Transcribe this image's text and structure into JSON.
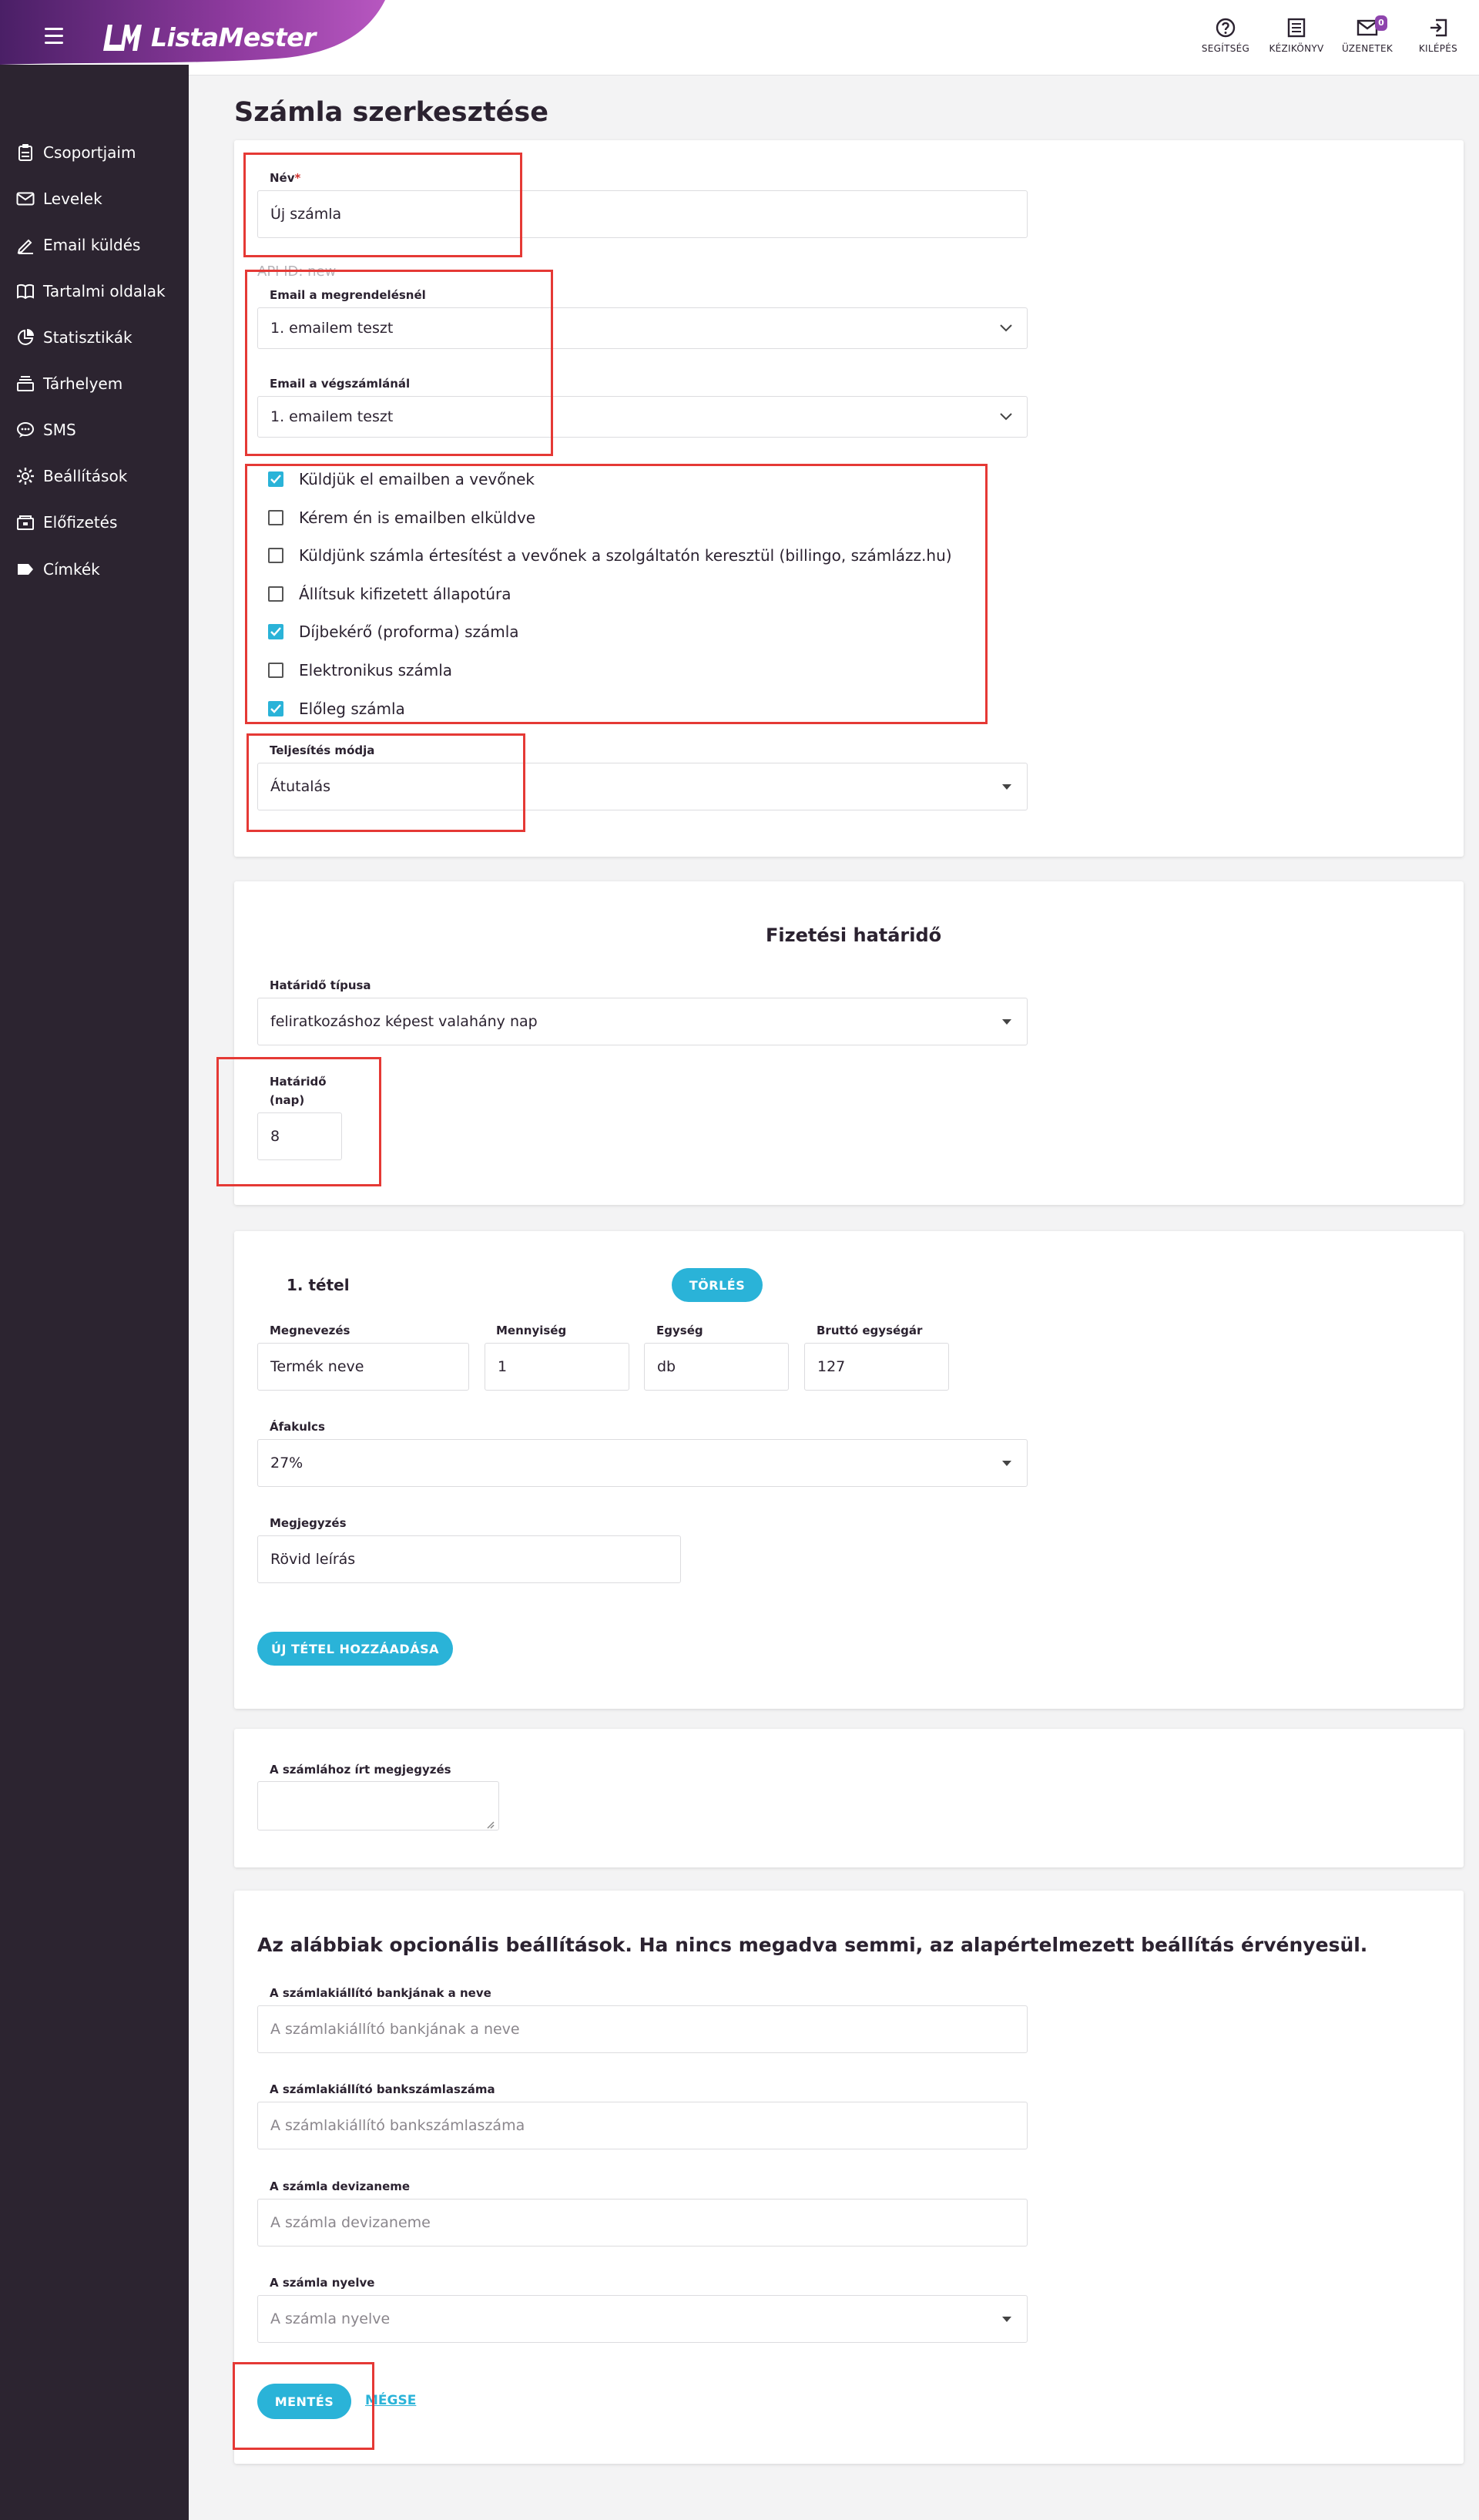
{
  "app": {
    "brand": "ListaMester"
  },
  "header": {
    "actions": [
      {
        "label": "SEGÍTSÉG",
        "icon": "help-circle-icon"
      },
      {
        "label": "KÉZIKÖNYV",
        "icon": "manual-icon"
      },
      {
        "label": "ÜZENETEK",
        "icon": "mail-icon",
        "badge": "0"
      },
      {
        "label": "KILÉPÉS",
        "icon": "logout-icon"
      }
    ]
  },
  "sidebar": {
    "items": [
      {
        "label": "Csoportjaim",
        "icon": "clipboard-icon"
      },
      {
        "label": "Levelek",
        "icon": "envelope-icon"
      },
      {
        "label": "Email küldés",
        "icon": "pen-icon"
      },
      {
        "label": "Tartalmi oldalak",
        "icon": "book-icon"
      },
      {
        "label": "Statisztikák",
        "icon": "pie-chart-icon"
      },
      {
        "label": "Tárhelyem",
        "icon": "storage-icon"
      },
      {
        "label": "SMS",
        "icon": "sms-icon"
      },
      {
        "label": "Beállítások",
        "icon": "gear-icon"
      },
      {
        "label": "Előfizetés",
        "icon": "subscription-icon"
      },
      {
        "label": "Címkék",
        "icon": "tag-icon"
      }
    ]
  },
  "page": {
    "title": "Számla szerkesztése"
  },
  "form": {
    "name_label": "Név",
    "name_required": "*",
    "name_value": "Új számla",
    "api_id": "API ID: new",
    "email_order_label": "Email a megrendelésnél",
    "email_order_value": "1. emailem teszt",
    "email_final_label": "Email a végszámlánál",
    "email_final_value": "1. emailem teszt",
    "checkboxes": [
      {
        "label": "Küldjük el emailben a vevőnek",
        "checked": true
      },
      {
        "label": "Kérem én is emailben elküldve",
        "checked": false
      },
      {
        "label": "Küldjünk számla értesítést a vevőnek a szolgáltatón keresztül (billingo, számlázz.hu)",
        "checked": false
      },
      {
        "label": "Állítsuk kifizetett állapotúra",
        "checked": false
      },
      {
        "label": "Díjbekérő (proforma) számla",
        "checked": true
      },
      {
        "label": "Elektronikus számla",
        "checked": false
      },
      {
        "label": "Előleg számla",
        "checked": true
      }
    ],
    "fulfillment_label": "Teljesítés módja",
    "fulfillment_value": "Átutalás"
  },
  "deadline": {
    "title": "Fizetési határidő",
    "type_label": "Határidő típusa",
    "type_value": "feliratkozáshoz képest valahány nap",
    "days_label_1": "Határidő",
    "days_label_2": "(nap)",
    "days_value": "8"
  },
  "item": {
    "title": "1. tétel",
    "delete_label": "TÖRLÉS",
    "name_label": "Megnevezés",
    "name_value": "Termék neve",
    "qty_label": "Mennyiség",
    "qty_value": "1",
    "unit_label": "Egység",
    "unit_value": "db",
    "price_label": "Bruttó egységár",
    "price_value": "127",
    "vat_label": "Áfakulcs",
    "vat_value": "27%",
    "note_label": "Megjegyzés",
    "note_value": "Rövid leírás",
    "add_label": "ÚJ TÉTEL HOZZÁADÁSA"
  },
  "invoice_note": {
    "label": "A számlához írt megjegyzés",
    "value": ""
  },
  "optional": {
    "title": "Az alábbiak opcionális beállítások. Ha nincs megadva semmi, az alapértelmezett beállítás érvényesül.",
    "bank_name_label": "A számlakiállító bankjának a neve",
    "bank_name_placeholder": "A számlakiállító bankjának a neve",
    "bank_account_label": "A számlakiállító bankszámlaszáma",
    "bank_account_placeholder": "A számlakiállító bankszámlaszáma",
    "currency_label": "A számla devizaneme",
    "currency_placeholder": "A számla devizaneme",
    "language_label": "A számla nyelve",
    "language_placeholder": "A számla nyelve",
    "save_label": "MENTÉS",
    "cancel_label": "MÉGSE"
  },
  "colors": {
    "accent": "#2ab3d8",
    "sidebar": "#2c2430",
    "brand_gradient_start": "#5a2a78",
    "brand_gradient_end": "#b04fb8",
    "highlight": "#e53935"
  }
}
